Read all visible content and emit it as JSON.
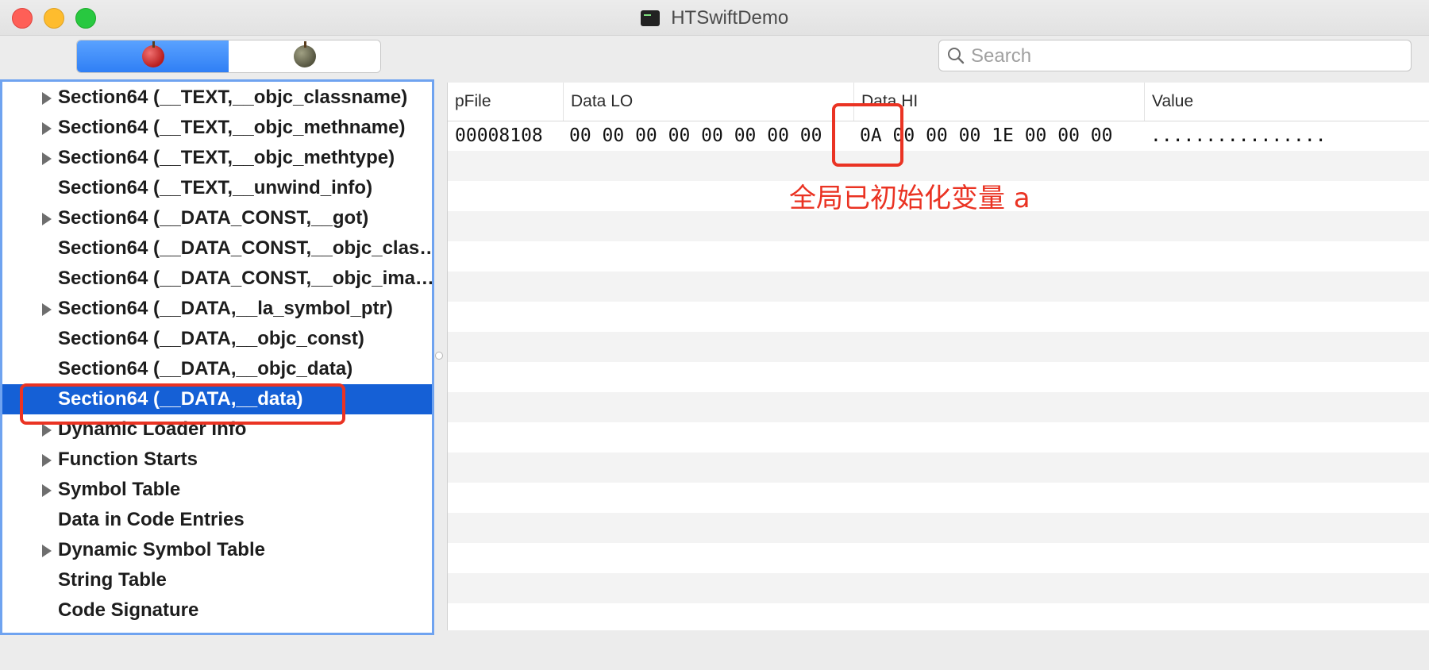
{
  "window": {
    "title": "HTSwiftDemo"
  },
  "toolbar": {
    "segment_left_icon": "red-apple-icon",
    "segment_right_icon": "gray-apple-icon",
    "search_placeholder": "Search"
  },
  "sidebar": {
    "items": [
      {
        "label": "Section64 (__TEXT,__objc_classname)",
        "expandable": true,
        "selected": false
      },
      {
        "label": "Section64 (__TEXT,__objc_methname)",
        "expandable": true,
        "selected": false
      },
      {
        "label": "Section64 (__TEXT,__objc_methtype)",
        "expandable": true,
        "selected": false
      },
      {
        "label": "Section64 (__TEXT,__unwind_info)",
        "expandable": false,
        "selected": false
      },
      {
        "label": "Section64 (__DATA_CONST,__got)",
        "expandable": true,
        "selected": false
      },
      {
        "label": "Section64 (__DATA_CONST,__objc_clas…",
        "expandable": false,
        "selected": false
      },
      {
        "label": "Section64 (__DATA_CONST,__objc_ima…",
        "expandable": false,
        "selected": false
      },
      {
        "label": "Section64 (__DATA,__la_symbol_ptr)",
        "expandable": true,
        "selected": false
      },
      {
        "label": "Section64 (__DATA,__objc_const)",
        "expandable": false,
        "selected": false
      },
      {
        "label": "Section64 (__DATA,__objc_data)",
        "expandable": false,
        "selected": false
      },
      {
        "label": "Section64 (__DATA,__data)",
        "expandable": false,
        "selected": true
      },
      {
        "label": "Dynamic Loader Info",
        "expandable": true,
        "selected": false
      },
      {
        "label": "Function Starts",
        "expandable": true,
        "selected": false
      },
      {
        "label": "Symbol Table",
        "expandable": true,
        "selected": false
      },
      {
        "label": "Data in Code Entries",
        "expandable": false,
        "selected": false
      },
      {
        "label": "Dynamic Symbol Table",
        "expandable": true,
        "selected": false
      },
      {
        "label": "String Table",
        "expandable": false,
        "selected": false
      },
      {
        "label": "Code Signature",
        "expandable": false,
        "selected": false
      }
    ]
  },
  "table": {
    "columns": [
      "pFile",
      "Data LO",
      "Data HI",
      "Value"
    ],
    "rows": [
      {
        "pFile": "00008108",
        "data_lo": "00 00 00 00 00 00 00 00",
        "data_hi": "0A 00 00 00 1E 00 00 00",
        "value": "................"
      }
    ]
  },
  "annotation": {
    "text": "全局已初始化变量 a",
    "color": "#ea3323"
  },
  "colors": {
    "selection": "#1560d6",
    "segment_active": "#2f7ff5",
    "focus_ring": "#6fa3f0"
  }
}
